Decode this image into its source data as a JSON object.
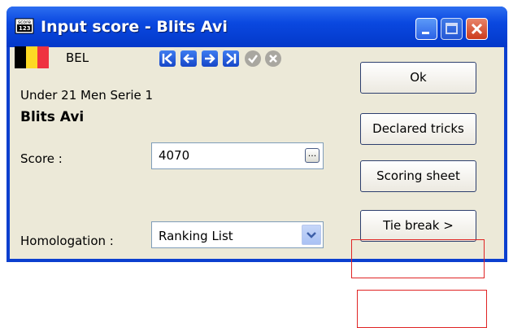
{
  "window": {
    "title": "Input score - Blits Avi",
    "icon_label": "score"
  },
  "competitor": {
    "country": "BEL",
    "category": "Under 21 Men Serie 1",
    "name": "Blits Avi"
  },
  "nav_icons": [
    "first-icon",
    "previous-icon",
    "next-icon",
    "last-icon",
    "confirm-icon",
    "cancel-icon"
  ],
  "fields": {
    "score_label": "Score :",
    "score_value": "4070",
    "score_picker": "...",
    "homologation_label": "Homologation :",
    "homologation_value": "Ranking List"
  },
  "buttons": {
    "ok": "Ok",
    "declared_tricks": "Declared tricks",
    "scoring_sheet": "Scoring sheet",
    "tie_break": "Tie break >"
  },
  "colors": {
    "titlebar": "#0a48e0",
    "face": "#ece9d8",
    "highlight_box": "#e02424"
  }
}
